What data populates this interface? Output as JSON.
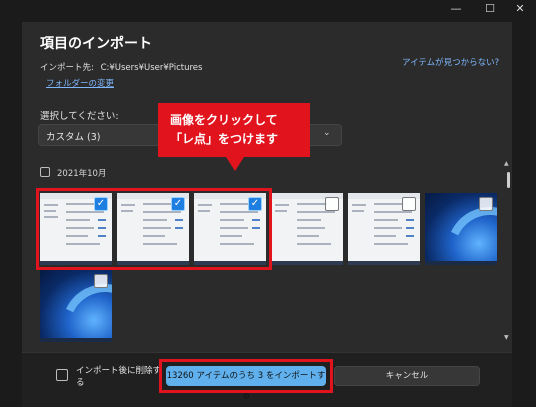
{
  "window": {
    "minimize": "—",
    "maximize": "☐",
    "close": "✕"
  },
  "dialog": {
    "title": "項目のインポート",
    "import_dest_label": "インポート先:",
    "import_dest_path": "C:¥Users¥User¥Pictures",
    "change_folder": "フォルダーの変更",
    "cant_find": "アイテムが見つからない?",
    "select_label": "選択してください:",
    "dropdown_value": "カスタム (3)",
    "group_label": "2021年10月"
  },
  "thumbnails": [
    {
      "kind": "document",
      "checked": true
    },
    {
      "kind": "document",
      "checked": true
    },
    {
      "kind": "document",
      "checked": true
    },
    {
      "kind": "document",
      "checked": false
    },
    {
      "kind": "document",
      "checked": false
    },
    {
      "kind": "wallpaper",
      "checked": false
    },
    {
      "kind": "wallpaper",
      "checked": false
    }
  ],
  "footer": {
    "delete_after_import": "インポート後に削除する",
    "import_button": "13260 アイテムのうち 3 をインポートする",
    "cancel_button": "キャンセル"
  },
  "annotation": {
    "line1": "画像をクリックして",
    "line2": "「レ点」をつけます"
  },
  "colors": {
    "accent": "#5fb0ec",
    "selection": "#4ea7ff",
    "annotation_red": "#e1141e"
  }
}
